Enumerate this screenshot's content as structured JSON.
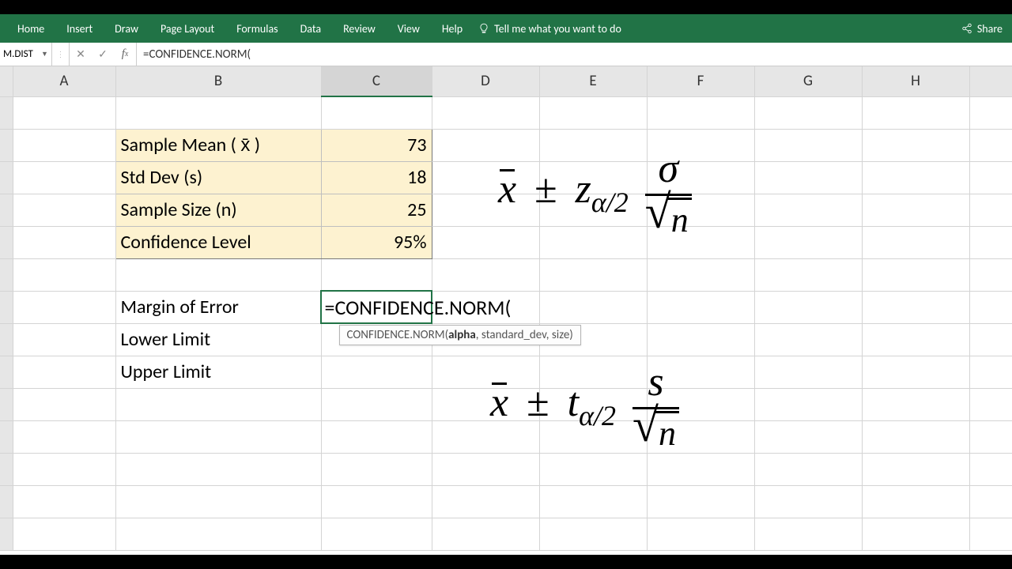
{
  "ribbon": {
    "tabs": [
      "Home",
      "Insert",
      "Draw",
      "Page Layout",
      "Formulas",
      "Data",
      "Review",
      "View",
      "Help"
    ],
    "tellme": "Tell me what you want to do",
    "share": "Share"
  },
  "formula_bar": {
    "name_box": "M.DIST",
    "formula": "=CONFIDENCE.NORM("
  },
  "columns": [
    "A",
    "B",
    "C",
    "D",
    "E",
    "F",
    "G",
    "H"
  ],
  "active_column": "C",
  "rows_visible": 14,
  "cells": {
    "B2": "Sample Mean ( x̄ )",
    "C2": "73",
    "B3": "Std Dev (s)",
    "C3": "18",
    "B4": "Sample Size (n)",
    "C4": "25",
    "B5": "Confidence Level",
    "C5": "95%",
    "B7": "Margin of Error",
    "C7_editing": "=CONFIDENCE.NORM(",
    "B8": "Lower Limit",
    "B9": "Upper Limit"
  },
  "tooltip": {
    "fn": "CONFIDENCE.NORM(",
    "arg_bold": "alpha",
    "rest": ", standard_dev, size)"
  },
  "equations": {
    "eq1": {
      "xbar": "x",
      "pm": "±",
      "coef": "z",
      "sub": "α/2",
      "num": "σ",
      "den": "n"
    },
    "eq2": {
      "xbar": "x",
      "pm": "±",
      "coef": "t",
      "sub": "α/2",
      "num": "s",
      "den": "n"
    }
  }
}
